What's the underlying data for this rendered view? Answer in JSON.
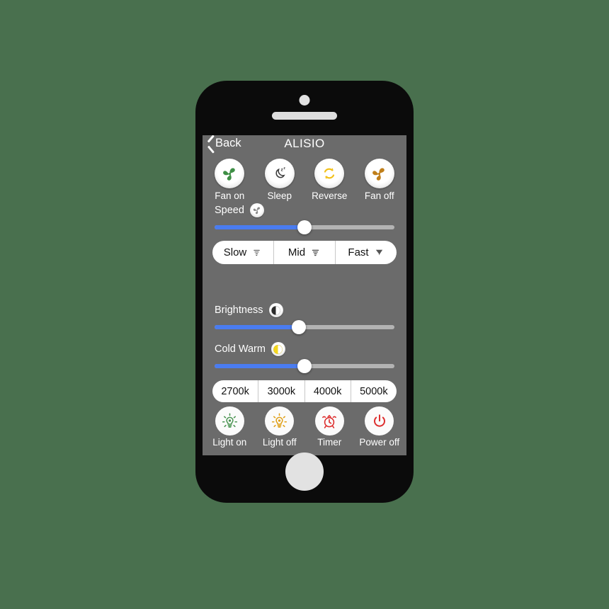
{
  "device": {
    "camera": "front-camera",
    "speaker": "earpiece-speaker",
    "home_button": "home-button"
  },
  "navbar": {
    "back_label": "Back",
    "title": "ALISIO"
  },
  "fan_controls": [
    {
      "label": "Fan on",
      "icon": "fan-icon",
      "color": "#3f8f46"
    },
    {
      "label": "Sleep",
      "icon": "moon-sleep-icon",
      "color": "#3a3a3a"
    },
    {
      "label": "Reverse",
      "icon": "reverse-loop-icon",
      "color": "#f2c018"
    },
    {
      "label": "Fan off",
      "icon": "fan-icon",
      "color": "#c07f1a"
    }
  ],
  "speed": {
    "label": "Speed",
    "icon": "fan-icon",
    "slider_value": 50,
    "options": [
      {
        "label": "Slow",
        "icon": "tornado-small-icon"
      },
      {
        "label": "Mid",
        "icon": "tornado-medium-icon"
      },
      {
        "label": "Fast",
        "icon": "tornado-large-icon"
      }
    ]
  },
  "brightness": {
    "label": "Brightness",
    "icon": "half-circle-icon",
    "slider_value": 47
  },
  "cold_warm": {
    "label": "Cold Warm",
    "icon": "half-circle-warm-icon",
    "slider_value": 50
  },
  "color_temperature": {
    "options": [
      "2700k",
      "3000k",
      "4000k",
      "5000k"
    ]
  },
  "light_controls": [
    {
      "label": "Light on",
      "icon": "bulb-on-icon",
      "color": "#4b9452"
    },
    {
      "label": "Light off",
      "icon": "bulb-off-icon",
      "color": "#e0a018"
    },
    {
      "label": "Timer",
      "icon": "alarm-clock-icon",
      "color": "#dd2e2e"
    },
    {
      "label": "Power off",
      "icon": "power-icon",
      "color": "#dd2e2e"
    }
  ],
  "colors": {
    "page_background": "#49704e",
    "screen_background": "#6b6b6b",
    "slider_fill": "#4a7cf0",
    "slider_track": "#b3b3b3",
    "phone_body": "#0b0b0b"
  }
}
